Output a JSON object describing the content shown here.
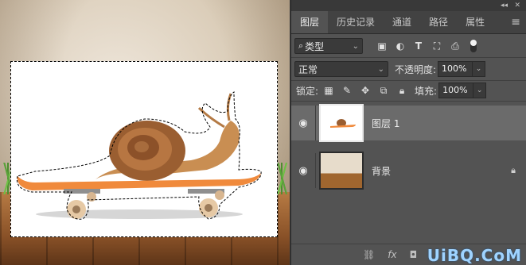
{
  "panel": {
    "tabs": [
      {
        "label": "图层"
      },
      {
        "label": "历史记录"
      },
      {
        "label": "通道"
      },
      {
        "label": "路径"
      },
      {
        "label": "属性"
      }
    ],
    "filter": {
      "value": "类型"
    },
    "blend_mode": {
      "value": "正常"
    },
    "opacity": {
      "label": "不透明度:",
      "value": "100%"
    },
    "lock": {
      "label": "锁定:"
    },
    "fill": {
      "label": "填充:",
      "value": "100%"
    },
    "layers": [
      {
        "name": "图层 1",
        "selected": true
      },
      {
        "name": "背景",
        "selected": false,
        "locked": true
      }
    ],
    "footer": {
      "fx": "fx"
    },
    "watermark": "UiBQ.CoM"
  },
  "colors": {
    "panel_bg": "#535353",
    "selected_layer": "#6b6b6b",
    "selection_marquee": "#000000",
    "board": "#f08a3c"
  },
  "icons": [
    "search-icon",
    "image-filter-icon",
    "adjustment-filter-icon",
    "type-filter-icon",
    "shape-filter-icon",
    "smart-object-filter-icon",
    "toggle-icon",
    "lock-pixels-icon",
    "lock-paint-icon",
    "lock-move-icon",
    "lock-artboard-icon",
    "lock-all-icon",
    "eye-icon",
    "lock-icon",
    "link-icon",
    "fx-icon"
  ]
}
